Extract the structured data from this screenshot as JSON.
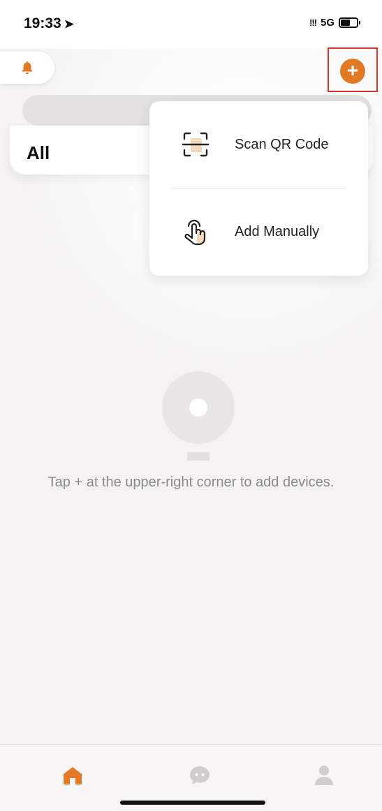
{
  "status_bar": {
    "time": "19:33",
    "location_icon": "location-arrow-icon",
    "signal": "!!!",
    "network": "5G",
    "battery_level": 0.6
  },
  "header": {
    "bell_icon": "bell-icon",
    "add_icon": "plus-icon",
    "add_label": "+"
  },
  "tabs": {
    "active": "All"
  },
  "menu": {
    "items": [
      {
        "label": "Scan QR Code",
        "icon": "scan-qr-icon"
      },
      {
        "label": "Add Manually",
        "icon": "tap-hand-icon"
      }
    ]
  },
  "empty_state": {
    "icon": "camera-device-icon",
    "message": "Tap + at the upper-right corner to add devices."
  },
  "tab_bar": {
    "items": [
      {
        "name": "home",
        "icon": "home-icon",
        "active": true
      },
      {
        "name": "messages",
        "icon": "chat-icon",
        "active": false
      },
      {
        "name": "profile",
        "icon": "user-icon",
        "active": false
      }
    ]
  },
  "colors": {
    "accent": "#e07a27",
    "highlight_border": "#d9362b",
    "background": "#f4f2f2",
    "muted_icon": "#cfcdcd"
  }
}
